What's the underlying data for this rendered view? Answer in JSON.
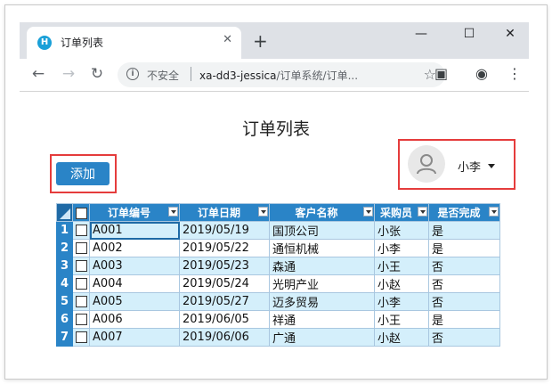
{
  "browser": {
    "tab_title": "订单列表",
    "tab_favicon_letter": "H",
    "new_tab": "+",
    "insecure_label": "不安全",
    "url_host": "xa-dd3-jessica",
    "url_path": "/订单系统/订单...",
    "icons": [
      "back-icon",
      "forward-icon",
      "reload-icon",
      "info-icon",
      "star-icon",
      "extension-icon",
      "account-icon",
      "menu-icon"
    ]
  },
  "page": {
    "title": "订单列表",
    "add_button": "添加",
    "user_name": "小李",
    "highlight_color": "#e53c3c",
    "accent_color": "#2a84c7"
  },
  "grid": {
    "columns": [
      "订单编号",
      "订单日期",
      "客户名称",
      "采购员",
      "是否完成"
    ],
    "rows": [
      {
        "num": "1",
        "cells": [
          "A001",
          "2019/05/19",
          "国顶公司",
          "小张",
          "是"
        ]
      },
      {
        "num": "2",
        "cells": [
          "A002",
          "2019/05/22",
          "通恒机械",
          "小李",
          "是"
        ]
      },
      {
        "num": "3",
        "cells": [
          "A003",
          "2019/05/23",
          "森通",
          "小王",
          "否"
        ]
      },
      {
        "num": "4",
        "cells": [
          "A004",
          "2019/05/24",
          "光明产业",
          "小赵",
          "否"
        ]
      },
      {
        "num": "5",
        "cells": [
          "A005",
          "2019/05/27",
          "迈多贸易",
          "小李",
          "否"
        ]
      },
      {
        "num": "6",
        "cells": [
          "A006",
          "2019/06/05",
          "祥通",
          "小王",
          "是"
        ]
      },
      {
        "num": "7",
        "cells": [
          "A007",
          "2019/06/06",
          "广通",
          "小赵",
          "否"
        ]
      }
    ]
  }
}
